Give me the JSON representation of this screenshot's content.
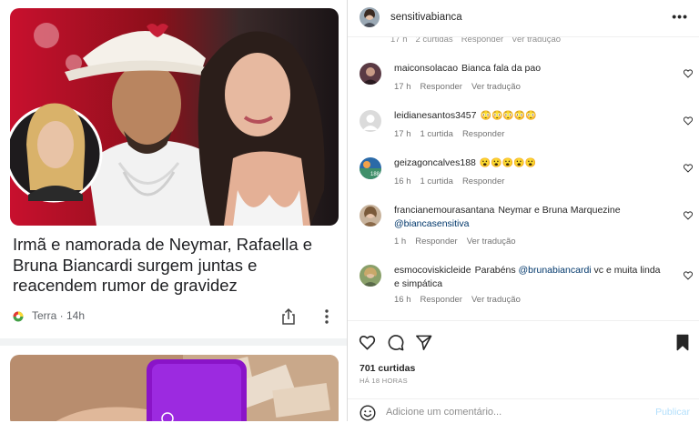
{
  "article": {
    "headline": "Irmã e namorada de Neymar, Rafaella e Bruna Biancardi surgem juntas e reacendem rumor de gravidez",
    "source": "Terra · 14h",
    "colors": {
      "source_icon": [
        "#e53935",
        "#fdd835",
        "#43a047"
      ]
    }
  },
  "post": {
    "username": "sensitivabianca",
    "more_label": "•••",
    "partial_row": [
      "17 h",
      "2 curtidas",
      "Responder",
      "Ver tradução"
    ],
    "comments": [
      {
        "user": "maiconsolacao",
        "text": "Bianca fala da pao",
        "mention": "",
        "text_after": "",
        "time": "17 h",
        "likes": "",
        "reply": "Responder",
        "translate": "Ver tradução"
      },
      {
        "user": "leidianesantos3457",
        "text": "😳😳😳😳😳",
        "mention": "",
        "text_after": "",
        "time": "17 h",
        "likes": "1 curtida",
        "reply": "Responder",
        "translate": ""
      },
      {
        "user": "geizagoncalves188",
        "text": "😮😮😮😮😮",
        "mention": "",
        "text_after": "",
        "time": "16 h",
        "likes": "1 curtida",
        "reply": "Responder",
        "translate": ""
      },
      {
        "user": "francianemourasantana",
        "text": "Neymar e Bruna Marquezine",
        "mention": "@biancasensitiva",
        "text_after": "",
        "time": "1 h",
        "likes": "",
        "reply": "Responder",
        "translate": "Ver tradução"
      },
      {
        "user": "esmocoviskicleide",
        "text": "Parabéns",
        "mention": "@brunabiancardi",
        "text_after": "vc e muita linda e simpática",
        "time": "16 h",
        "likes": "",
        "reply": "Responder",
        "translate": "Ver tradução"
      }
    ],
    "likes_count": "701 curtidas",
    "time_ago": "HÁ 18 HORAS",
    "add_comment_placeholder": "Adicione um comentário...",
    "publish_label": "Publicar"
  }
}
